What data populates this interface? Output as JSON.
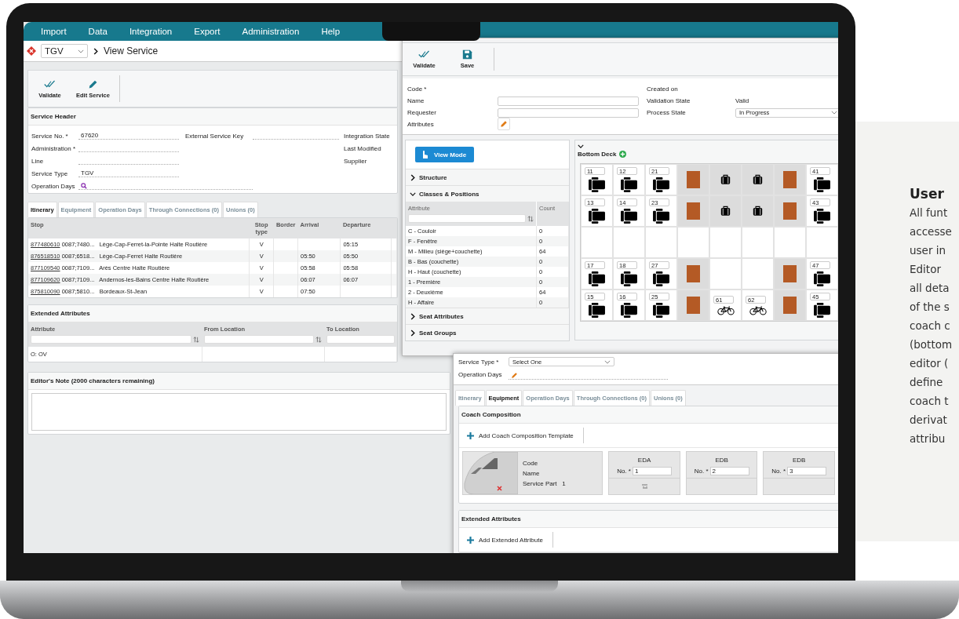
{
  "menu": [
    "Import",
    "Data",
    "Integration",
    "Export",
    "Administration",
    "Help"
  ],
  "breadcrumb": {
    "selector": "TGV",
    "page": "View Service"
  },
  "toolbar": [
    {
      "kind": "validate",
      "label": "Validate"
    },
    {
      "kind": "edit",
      "label": "Edit Service"
    }
  ],
  "service_header": {
    "title": "Service Header",
    "left_fields": [
      {
        "label": "Service No. *",
        "value": "67620"
      },
      {
        "label": "Administration *"
      },
      {
        "label": "Line"
      },
      {
        "label": "Service Type",
        "value": "TGV"
      },
      {
        "label": "Operation Days",
        "kind": "search"
      }
    ],
    "middle_fields": [
      {
        "label": "External Service Key"
      }
    ],
    "right_fields": [
      {
        "label": "Integration State"
      },
      {
        "label": "Last Modified"
      },
      {
        "label": "Supplier"
      }
    ]
  },
  "tabs": [
    {
      "label": "Itinerary",
      "selected": true
    },
    {
      "label": "Equipment",
      "selected": false
    },
    {
      "label": "Operation Days",
      "selected": false
    },
    {
      "label": "Through Connections (0)",
      "selected": false
    },
    {
      "label": "Unions (0)",
      "selected": false
    }
  ],
  "itinerary": {
    "columns": [
      "Stop",
      "Stop type",
      "Border",
      "Arrival",
      "Departure"
    ],
    "rows": [
      {
        "code": "877480610",
        "ref": "0087;7480...",
        "name": "Lège-Cap-Ferret-la-Pointe Halte Routière",
        "stop_type": "V",
        "departure": "05:15"
      },
      {
        "code": "876518510",
        "ref": "0087;6518...",
        "name": "Lège-Cap-Ferret Halte Routière",
        "stop_type": "V",
        "arrival": "05:50",
        "departure": "05:50"
      },
      {
        "code": "877109540",
        "ref": "0087;7109...",
        "name": "Arès Centre Halte Routière",
        "stop_type": "V",
        "arrival": "05:58",
        "departure": "05:58"
      },
      {
        "code": "877109620",
        "ref": "0087;7109...",
        "name": "Andernos-les-Bains Centre Halte Routière",
        "stop_type": "V",
        "arrival": "06:07",
        "departure": "06:07"
      },
      {
        "code": "875810090",
        "ref": "0087;5810...",
        "name": "Bordeaux-St-Jean",
        "stop_type": "V",
        "arrival": "07:50"
      }
    ]
  },
  "extended_attributes": {
    "title": "Extended Attributes",
    "columns": [
      "Attribute",
      "From Location",
      "To Location"
    ],
    "rows": [
      [
        "O: OV"
      ]
    ]
  },
  "editors_note": {
    "title": "Editor's Note (2000 characters remaining)"
  },
  "coach_editor": {
    "toolbar": [
      {
        "kind": "validate",
        "label": "Validate"
      },
      {
        "kind": "save",
        "label": "Save"
      }
    ],
    "left_fields": [
      {
        "label": "Code *"
      },
      {
        "label": "Name",
        "kind": "input"
      },
      {
        "label": "Requester",
        "kind": "input"
      },
      {
        "label": "Attributes",
        "kind": "edit"
      }
    ],
    "right_fields": [
      {
        "label": "Created on"
      },
      {
        "label": "Validation State",
        "value": "Valid"
      },
      {
        "label": "Process State",
        "value": "In Progress",
        "kind": "select"
      }
    ],
    "view_mode_button": "View Mode",
    "sections_before": [
      {
        "title": "Structure",
        "expanded": false
      },
      {
        "title": "Classes & Positions",
        "expanded": true
      }
    ],
    "classes_table": {
      "columns": [
        "Attribute",
        "Count"
      ],
      "rows": [
        {
          "attribute": "C - Couloir",
          "count": "0"
        },
        {
          "attribute": "F - Fenêtre",
          "count": "0"
        },
        {
          "attribute": "M - Milieu (siège+couchette)",
          "count": "64"
        },
        {
          "attribute": "B - Bas (couchette)",
          "count": "0"
        },
        {
          "attribute": "H - Haut (couchette)",
          "count": "0"
        },
        {
          "attribute": "1 - Première",
          "count": "0"
        },
        {
          "attribute": "2 - Deuxième",
          "count": "64"
        },
        {
          "attribute": "H - Affaire",
          "count": "0"
        }
      ]
    },
    "sections_after": [
      {
        "title": "Seat Attributes",
        "expanded": false
      },
      {
        "title": "Seat Groups",
        "expanded": false
      }
    ],
    "deck": {
      "title": "Bottom Deck",
      "rows": [
        [
          {
            "kind": "seat",
            "number": "11"
          },
          {
            "kind": "seat",
            "number": "12"
          },
          {
            "kind": "seat",
            "number": "21"
          },
          {
            "kind": "block"
          },
          {
            "kind": "luggage"
          },
          {
            "kind": "luggage"
          },
          {
            "kind": "block"
          },
          {
            "kind": "seat",
            "number": "41"
          }
        ],
        [
          {
            "kind": "seat",
            "number": "13"
          },
          {
            "kind": "seat",
            "number": "14"
          },
          {
            "kind": "seat",
            "number": "23"
          },
          {
            "kind": "block"
          },
          {
            "kind": "luggage"
          },
          {
            "kind": "luggage"
          },
          {
            "kind": "block"
          },
          {
            "kind": "seat",
            "number": "43"
          }
        ],
        [
          {
            "kind": "empty"
          },
          {
            "kind": "empty"
          },
          {
            "kind": "empty"
          },
          {
            "kind": "empty"
          },
          {
            "kind": "empty"
          },
          {
            "kind": "empty"
          },
          {
            "kind": "empty"
          },
          {
            "kind": "empty"
          }
        ],
        [
          {
            "kind": "seat",
            "number": "17"
          },
          {
            "kind": "seat",
            "number": "18"
          },
          {
            "kind": "seat",
            "number": "27"
          },
          {
            "kind": "block"
          },
          {
            "kind": "empty"
          },
          {
            "kind": "empty"
          },
          {
            "kind": "block"
          },
          {
            "kind": "seat",
            "number": "47"
          }
        ],
        [
          {
            "kind": "seat",
            "number": "15"
          },
          {
            "kind": "seat",
            "number": "16"
          },
          {
            "kind": "seat",
            "number": "25"
          },
          {
            "kind": "block"
          },
          {
            "kind": "bike",
            "number": "61"
          },
          {
            "kind": "bike",
            "number": "62"
          },
          {
            "kind": "block"
          },
          {
            "kind": "seat",
            "number": "45"
          }
        ]
      ]
    }
  },
  "service_editor": {
    "fields": [
      {
        "label": "Service Type *",
        "value": "Select One",
        "kind": "select"
      },
      {
        "label": "Operation Days",
        "kind": "edit"
      }
    ],
    "tabs": [
      {
        "label": "Itinerary",
        "selected": false
      },
      {
        "label": "Equipment",
        "selected": true
      },
      {
        "label": "Operation Days",
        "selected": false
      },
      {
        "label": "Through Connections (0)",
        "selected": false
      },
      {
        "label": "Unions (0)",
        "selected": false
      }
    ],
    "coach_composition": {
      "title": "Coach Composition",
      "add_button": "Add Coach Composition Template",
      "head": {
        "fields": [
          {
            "label": "Code"
          },
          {
            "label": "Name"
          },
          {
            "label": "Service Part",
            "value": "1"
          }
        ]
      },
      "coaches": [
        {
          "code": "EDA",
          "no_label": "No. *",
          "no": "1",
          "has_icon": true
        },
        {
          "code": "EDB",
          "no_label": "No. *",
          "no": "2",
          "has_icon": false
        },
        {
          "code": "EDB",
          "no_label": "No. *",
          "no": "3",
          "has_icon": false
        }
      ]
    },
    "extended_attributes": {
      "title": "Extended Attributes",
      "add_button": "Add Extended Attribute"
    }
  },
  "side_panel": {
    "title": "User",
    "lines": [
      "All funt",
      "accesse",
      "user in",
      "Editor",
      "all deta",
      "of the s",
      "coach c",
      "(bottom",
      "editor (",
      "define",
      "coach t",
      "derivat",
      "attribu"
    ]
  }
}
